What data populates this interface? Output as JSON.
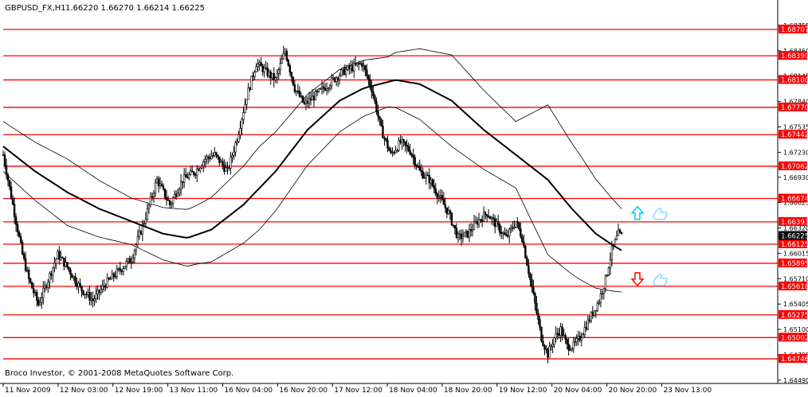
{
  "header": {
    "symbol": "GBPUSD_FX,H1",
    "ohlc": "1.66220 1.66270 1.66214 1.66225"
  },
  "footer": {
    "copyright": "Broco Investor, © 2001-2008 MetaQuotes Software Corp."
  },
  "colors": {
    "background": "#ffffff",
    "candle": "#000000",
    "level_line": "#ff0000",
    "level_label_bg": "#ff0000",
    "level_label_text": "#ffffff",
    "current_label_bg": "#000000",
    "arrow_up": "#00c8ff",
    "arrow_down": "#ff0000",
    "hand_icon": "#7fd3ff"
  },
  "icons": {
    "up_arrow": "up-arrow-icon",
    "down_arrow": "down-arrow-icon",
    "thumbs_up": "thumbs-up-icon"
  },
  "chart_data": {
    "type": "candlestick",
    "title": "GBPUSD_FX,H1",
    "ylim": [
      1.6445,
      1.6886
    ],
    "y_ticks": [
      "1.68755",
      "1.68450",
      "1.68145",
      "1.67840",
      "1.67535",
      "1.67230",
      "1.66930",
      "1.66625",
      "1.66320",
      "1.66015",
      "1.65710",
      "1.65405",
      "1.65100",
      "1.64795",
      "1.64490"
    ],
    "x_ticks": [
      "11 Nov 2009",
      "12 Nov 03:00",
      "12 Nov 19:00",
      "13 Nov 11:00",
      "16 Nov 04:00",
      "16 Nov 20:00",
      "17 Nov 12:00",
      "18 Nov 04:00",
      "18 Nov 20:00",
      "19 Nov 12:00",
      "20 Nov 04:00",
      "20 Nov 20:00",
      "23 Nov 13:00"
    ],
    "levels": [
      {
        "label": "1.68707",
        "value": 1.68707
      },
      {
        "label": "1.68390",
        "value": 1.6839
      },
      {
        "label": "1.68100",
        "value": 1.681
      },
      {
        "label": "1.67770",
        "value": 1.6777
      },
      {
        "label": "1.67442",
        "value": 1.67442
      },
      {
        "label": "1.67062",
        "value": 1.67062
      },
      {
        "label": "1.66674",
        "value": 1.66674
      },
      {
        "label": "1.66393",
        "value": 1.66393
      },
      {
        "label": "1.66125",
        "value": 1.66125
      },
      {
        "label": "1.65895",
        "value": 1.65895
      },
      {
        "label": "1.65618",
        "value": 1.65618
      },
      {
        "label": "1.65275",
        "value": 1.65275
      },
      {
        "label": "1.65002",
        "value": 1.65002
      },
      {
        "label": "1.64746",
        "value": 1.64746
      }
    ],
    "current_price": {
      "label": "1.66225",
      "value": 1.66225
    },
    "price_path": [
      [
        0,
        1.672
      ],
      [
        4,
        1.668
      ],
      [
        8,
        1.664
      ],
      [
        12,
        1.66
      ],
      [
        16,
        1.657
      ],
      [
        22,
        1.654
      ],
      [
        28,
        1.657
      ],
      [
        34,
        1.66
      ],
      [
        40,
        1.6585
      ],
      [
        48,
        1.656
      ],
      [
        56,
        1.6545
      ],
      [
        64,
        1.6565
      ],
      [
        72,
        1.658
      ],
      [
        80,
        1.6595
      ],
      [
        88,
        1.664
      ],
      [
        96,
        1.669
      ],
      [
        104,
        1.666
      ],
      [
        112,
        1.669
      ],
      [
        120,
        1.67
      ],
      [
        126,
        1.6715
      ],
      [
        132,
        1.672
      ],
      [
        140,
        1.67
      ],
      [
        146,
        1.674
      ],
      [
        152,
        1.679
      ],
      [
        158,
        1.683
      ],
      [
        164,
        1.682
      ],
      [
        170,
        1.681
      ],
      [
        176,
        1.6845
      ],
      [
        182,
        1.68
      ],
      [
        188,
        1.678
      ],
      [
        194,
        1.679
      ],
      [
        200,
        1.68
      ],
      [
        206,
        1.681
      ],
      [
        212,
        1.682
      ],
      [
        218,
        1.6825
      ],
      [
        224,
        1.683
      ],
      [
        230,
        1.68
      ],
      [
        236,
        1.675
      ],
      [
        242,
        1.672
      ],
      [
        248,
        1.6735
      ],
      [
        254,
        1.6725
      ],
      [
        260,
        1.67
      ],
      [
        266,
        1.669
      ],
      [
        272,
        1.667
      ],
      [
        278,
        1.665
      ],
      [
        284,
        1.662
      ],
      [
        290,
        1.6625
      ],
      [
        296,
        1.664
      ],
      [
        302,
        1.665
      ],
      [
        308,
        1.6635
      ],
      [
        314,
        1.662
      ],
      [
        320,
        1.664
      ],
      [
        324,
        1.662
      ],
      [
        328,
        1.658
      ],
      [
        332,
        1.654
      ],
      [
        336,
        1.65
      ],
      [
        340,
        1.648
      ],
      [
        344,
        1.65
      ],
      [
        348,
        1.651
      ],
      [
        352,
        1.649
      ],
      [
        356,
        1.649
      ],
      [
        360,
        1.65
      ],
      [
        364,
        1.6515
      ],
      [
        368,
        1.653
      ],
      [
        372,
        1.6545
      ],
      [
        376,
        1.657
      ],
      [
        380,
        1.6605
      ],
      [
        384,
        1.6625
      ],
      [
        386,
        1.6622
      ]
    ],
    "ma_path": [
      [
        0,
        1.673
      ],
      [
        20,
        1.67
      ],
      [
        40,
        1.6675
      ],
      [
        60,
        1.6655
      ],
      [
        80,
        1.664
      ],
      [
        100,
        1.6625
      ],
      [
        115,
        1.662
      ],
      [
        130,
        1.663
      ],
      [
        150,
        1.666
      ],
      [
        170,
        1.67
      ],
      [
        190,
        1.675
      ],
      [
        210,
        1.6785
      ],
      [
        225,
        1.68
      ],
      [
        245,
        1.681
      ],
      [
        260,
        1.6805
      ],
      [
        280,
        1.6785
      ],
      [
        300,
        1.675
      ],
      [
        320,
        1.672
      ],
      [
        340,
        1.669
      ],
      [
        355,
        1.6655
      ],
      [
        370,
        1.6625
      ],
      [
        380,
        1.6612
      ],
      [
        386,
        1.6605
      ]
    ],
    "band_halfwidth": [
      [
        0,
        0.003
      ],
      [
        40,
        0.004
      ],
      [
        80,
        0.0028
      ],
      [
        120,
        0.0035
      ],
      [
        160,
        0.005
      ],
      [
        200,
        0.004
      ],
      [
        240,
        0.003
      ],
      [
        280,
        0.0055
      ],
      [
        320,
        0.004
      ],
      [
        340,
        0.009
      ],
      [
        360,
        0.0075
      ],
      [
        386,
        0.005
      ]
    ]
  },
  "annotations": {
    "up_arrow_price": 1.665,
    "down_arrow_price": 1.658
  }
}
